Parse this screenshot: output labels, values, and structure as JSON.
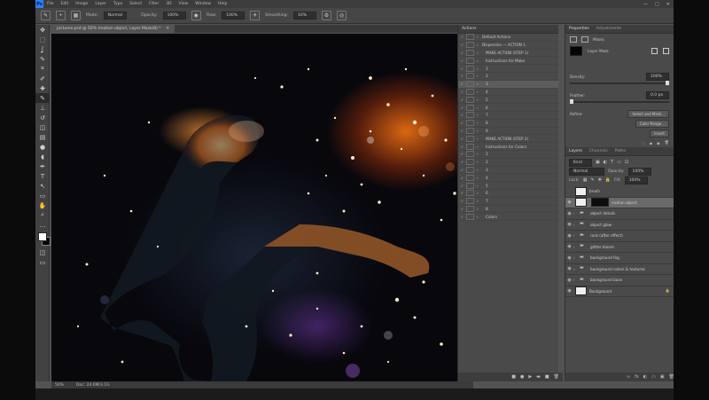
{
  "app": {
    "logo": "Ps",
    "menu": [
      "File",
      "Edit",
      "Image",
      "Layer",
      "Type",
      "Select",
      "Filter",
      "3D",
      "View",
      "Window",
      "Help"
    ],
    "window_controls": [
      "—",
      "□",
      "✕"
    ]
  },
  "options_bar": {
    "mode_label": "Mode:",
    "mode_value": "Normal",
    "opacity_label": "Opacity:",
    "opacity_value": "100%",
    "flow_label": "Flow:",
    "flow_value": "100%",
    "smoothing_label": "Smoothing:",
    "smoothing_value": "10%"
  },
  "document": {
    "tab_title": "pictures.psd @ 50% (motion object, Layer Mask/8) *",
    "zoom": "50%",
    "doc_info": "Doc: 24.6M/3.1G"
  },
  "actions_panel": {
    "title": "Actions",
    "rows": [
      {
        "label": "Default Actions",
        "checked": true,
        "folder": true,
        "selected": false
      },
      {
        "label": "Dispersion  —  ACTION 1",
        "checked": true,
        "folder": true,
        "selected": false
      },
      {
        "label": "MAKE ACTION (STEP 1)",
        "checked": true,
        "folder": false,
        "selected": false
      },
      {
        "label": "Instructions for Make",
        "checked": true,
        "folder": false,
        "selected": false
      },
      {
        "label": "1",
        "checked": true,
        "folder": false,
        "selected": false
      },
      {
        "label": "2",
        "checked": true,
        "folder": false,
        "selected": false
      },
      {
        "label": "3",
        "checked": true,
        "folder": false,
        "selected": true
      },
      {
        "label": "4",
        "checked": true,
        "folder": false,
        "selected": false
      },
      {
        "label": "5",
        "checked": true,
        "folder": false,
        "selected": false
      },
      {
        "label": "6",
        "checked": true,
        "folder": false,
        "selected": false
      },
      {
        "label": "7",
        "checked": true,
        "folder": false,
        "selected": false
      },
      {
        "label": "8",
        "checked": true,
        "folder": false,
        "selected": false
      },
      {
        "label": "9",
        "checked": true,
        "folder": false,
        "selected": false
      },
      {
        "label": "MAKE ACTION (STEP 2)",
        "checked": true,
        "folder": false,
        "selected": false
      },
      {
        "label": "Instructions for Colors",
        "checked": true,
        "folder": false,
        "selected": false
      },
      {
        "label": "1",
        "checked": true,
        "folder": false,
        "selected": false
      },
      {
        "label": "2",
        "checked": true,
        "folder": false,
        "selected": false
      },
      {
        "label": "3",
        "checked": true,
        "folder": false,
        "selected": false
      },
      {
        "label": "4",
        "checked": true,
        "folder": false,
        "selected": false
      },
      {
        "label": "5",
        "checked": true,
        "folder": false,
        "selected": false
      },
      {
        "label": "6",
        "checked": true,
        "folder": false,
        "selected": false
      },
      {
        "label": "7",
        "checked": true,
        "folder": false,
        "selected": false
      },
      {
        "label": "8",
        "checked": true,
        "folder": false,
        "selected": false
      },
      {
        "label": "Colors",
        "checked": true,
        "folder": false,
        "selected": false
      }
    ],
    "footer_icons": [
      "■",
      "●",
      "▶",
      "▬",
      "■",
      "🗑"
    ]
  },
  "properties_panel": {
    "tabs": [
      "Properties",
      "Adjustments"
    ],
    "section_label": "Masks",
    "mask_label": "Layer Mask",
    "density_label": "Density:",
    "density_value": "100%",
    "feather_label": "Feather:",
    "feather_value": "0.0 px",
    "refine_label": "Refine:",
    "select_mask_button": "Select and Mask...",
    "color_range_button": "Color Range...",
    "invert_button": "Invert"
  },
  "layers_panel": {
    "tabs": [
      "Layers",
      "Channels",
      "Paths"
    ],
    "filter_kind": "Kind",
    "blend_mode": "Normal",
    "opacity_label": "Opacity:",
    "opacity_value": "100%",
    "lock_label": "Lock:",
    "fill_label": "Fill:",
    "fill_value": "100%",
    "layers": [
      {
        "name": "brush",
        "type": "pixel",
        "visible": false,
        "selected": false,
        "mask": false
      },
      {
        "name": "motion object",
        "type": "pixel",
        "visible": true,
        "selected": true,
        "mask": true
      },
      {
        "name": "object details",
        "type": "folder",
        "visible": true,
        "selected": false,
        "mask": false
      },
      {
        "name": "object glow",
        "type": "folder",
        "visible": true,
        "selected": false,
        "mask": false
      },
      {
        "name": "rock (after effect)",
        "type": "folder",
        "visible": true,
        "selected": false,
        "mask": false
      },
      {
        "name": "glitter bloom",
        "type": "folder",
        "visible": true,
        "selected": false,
        "mask": false
      },
      {
        "name": "background fog",
        "type": "folder",
        "visible": true,
        "selected": false,
        "mask": false
      },
      {
        "name": "background colors & textures",
        "type": "folder",
        "visible": true,
        "selected": false,
        "mask": false
      },
      {
        "name": "background base",
        "type": "folder",
        "visible": true,
        "selected": false,
        "mask": false
      },
      {
        "name": "Background",
        "type": "pixel",
        "visible": true,
        "selected": false,
        "mask": false
      }
    ],
    "footer_icons": [
      "∞",
      "fx",
      "◐",
      "▭",
      "▣",
      "🗑"
    ]
  },
  "toolbar": {
    "tools": [
      "move-tool",
      "marquee-tool",
      "lasso-tool",
      "quick-select-tool",
      "crop-tool",
      "eyedropper-tool",
      "healing-tool",
      "brush-tool",
      "stamp-tool",
      "history-brush-tool",
      "eraser-tool",
      "gradient-tool",
      "blur-tool",
      "dodge-tool",
      "pen-tool",
      "type-tool",
      "path-select-tool",
      "shape-tool",
      "hand-tool",
      "zoom-tool",
      "more-tools"
    ],
    "glyphs": [
      "✥",
      "⬚",
      "ʆ",
      "✎",
      "⌗",
      "✐",
      "✚",
      "✎",
      "⊥",
      "↺",
      "◫",
      "▤",
      "●",
      "◖",
      "✒",
      "T",
      "↖",
      "▭",
      "✋",
      "⌕",
      "…"
    ]
  },
  "colors": {
    "accent": "#2b80ff",
    "fg_color": "#ffffff",
    "bg_color": "#000000"
  }
}
